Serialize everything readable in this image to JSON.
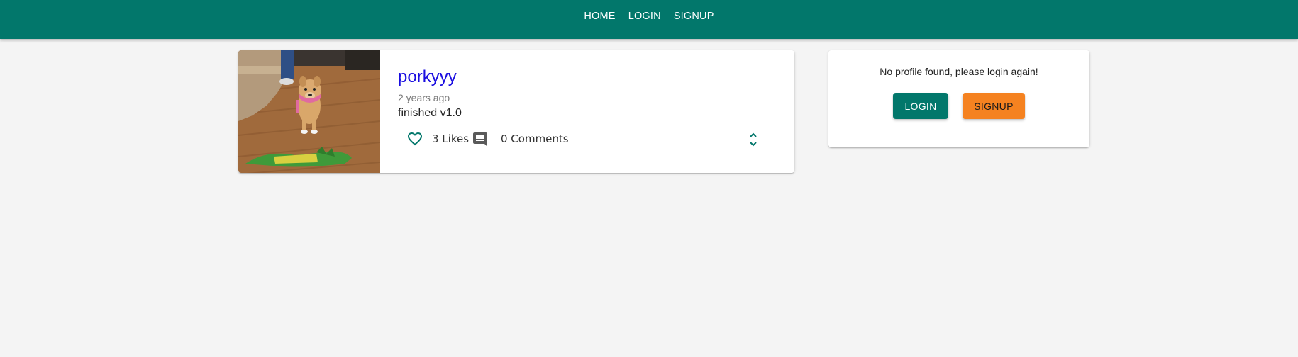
{
  "nav": {
    "links": [
      "HOME",
      "LOGIN",
      "SIGNUP"
    ]
  },
  "post": {
    "title": "porkyyy",
    "time": "2 years ago",
    "text": "finished v1.0",
    "likes_label": "3 Likes",
    "comments_label": "0 Comments",
    "image_desc": "dog-photo"
  },
  "profile": {
    "message": "No profile found, please login again!",
    "login_label": "LOGIN",
    "signup_label": "SIGNUP"
  },
  "colors": {
    "primary": "#02776b",
    "accent": "#f58220",
    "link": "#1a0de0",
    "background": "#f4f4f4"
  },
  "icons": {
    "like": "heart-outline-icon",
    "comment": "comment-icon",
    "expand": "unfold-more-icon"
  }
}
